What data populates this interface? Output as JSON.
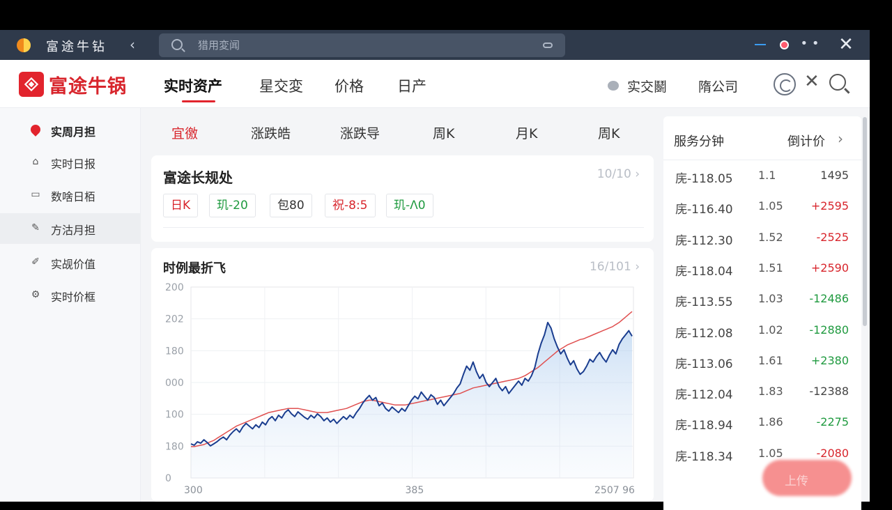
{
  "titlebar": {
    "app_name": "富途牛钻",
    "search_placeholder": "猎用変闻"
  },
  "navbar": {
    "logo": "富途牛锅",
    "tabs": [
      "实时资产",
      "星交変",
      "价格",
      "日产"
    ],
    "right_items": [
      "实交鬭",
      "隋公司"
    ]
  },
  "sidebar": {
    "items": [
      {
        "label": "实周月担",
        "icon": "map-pin-icon"
      },
      {
        "label": "实时日报",
        "icon": "home-icon"
      },
      {
        "label": "数啥日栢",
        "icon": "calendar-icon"
      },
      {
        "label": "方沽月担",
        "icon": "edit-icon"
      },
      {
        "label": "实觇价值",
        "icon": "chart-edit-icon"
      },
      {
        "label": "实时价框",
        "icon": "settings-icon"
      }
    ]
  },
  "subtabs": [
    "宜徼",
    "涨跌皓",
    "涨跌导",
    "周K",
    "月K",
    "周K"
  ],
  "summary_card": {
    "title": "富途长规处",
    "page": "10/10",
    "chips": [
      {
        "text": "日K",
        "tone": "red"
      },
      {
        "text": "玑-20",
        "tone": "green"
      },
      {
        "text": "包80",
        "tone": "dark"
      },
      {
        "text": "祝-8:5",
        "tone": "red"
      },
      {
        "text": "玑-Λ0",
        "tone": "green"
      }
    ]
  },
  "chart_card": {
    "title": "时例最折飞",
    "page": "16/101"
  },
  "chart_data": {
    "type": "line",
    "y_tick_labels": [
      "200",
      "202",
      "180",
      "000",
      "100",
      "180",
      "0"
    ],
    "x_tick_labels": [
      "300",
      "",
      "",
      "385",
      "",
      "",
      "2507 96"
    ],
    "series": [
      {
        "name": "",
        "color": "#1a3d8f",
        "values": [
          130,
          128,
          133,
          131,
          136,
          132,
          127,
          130,
          133,
          137,
          140,
          136,
          143,
          148,
          152,
          147,
          155,
          160,
          156,
          152,
          158,
          154,
          162,
          158,
          166,
          170,
          164,
          172,
          168,
          176,
          180,
          174,
          170,
          177,
          173,
          169,
          166,
          172,
          168,
          174,
          170,
          164,
          168,
          162,
          166,
          160,
          165,
          170,
          166,
          172,
          168,
          176,
          182,
          190,
          196,
          201,
          194,
          198,
          186,
          190,
          182,
          178,
          184,
          180,
          176,
          182,
          178,
          186,
          194,
          200,
          196,
          206,
          200,
          194,
          202,
          198,
          188,
          194,
          186,
          192,
          198,
          204,
          212,
          218,
          232,
          244,
          238,
          250,
          236,
          226,
          232,
          220,
          214,
          220,
          226,
          214,
          208,
          214,
          204,
          210,
          216,
          222,
          216,
          226,
          222,
          230,
          242,
          262,
          278,
          290,
          308,
          300,
          284,
          272,
          262,
          268,
          256,
          246,
          252,
          240,
          232,
          236,
          244,
          254,
          250,
          258,
          264,
          256,
          250,
          260,
          268,
          262,
          276,
          284,
          290,
          296,
          288
        ]
      },
      {
        "name": "",
        "color": "#e05050",
        "values": [
          126,
          126,
          127,
          128,
          129,
          131,
          133,
          135,
          138,
          141,
          144,
          147,
          150,
          153,
          156,
          158,
          160,
          162,
          164,
          166,
          168,
          170,
          172,
          174,
          176,
          177,
          178,
          179,
          180,
          181,
          182,
          182,
          182,
          182,
          181,
          180,
          179,
          178,
          177,
          176,
          176,
          176,
          176,
          177,
          178,
          179,
          180,
          181,
          182,
          184,
          186,
          188,
          190,
          192,
          193,
          194,
          194,
          193,
          192,
          191,
          190,
          189,
          188,
          187,
          187,
          187,
          187,
          188,
          189,
          190,
          191,
          192,
          193,
          194,
          195,
          196,
          197,
          198,
          199,
          200,
          201,
          202,
          203,
          204,
          206,
          208,
          210,
          212,
          213,
          214,
          215,
          216,
          217,
          218,
          219,
          220,
          221,
          222,
          223,
          224,
          225,
          226,
          228,
          230,
          233,
          236,
          239,
          242,
          246,
          250,
          254,
          258,
          262,
          266,
          269,
          272,
          275,
          277,
          279,
          281,
          283,
          284,
          286,
          288,
          290,
          292,
          294,
          296,
          298,
          300,
          302,
          305,
          308,
          312,
          316,
          320,
          324
        ]
      }
    ]
  },
  "right_panel": {
    "header_left": "服务分钟",
    "header_right": "倒计价",
    "rows": [
      {
        "name": "庑-118.05",
        "mid": "1.1",
        "value": "1495",
        "tone": "neu"
      },
      {
        "name": "庑-116.40",
        "mid": "1.05",
        "value": "+2595",
        "tone": "pos"
      },
      {
        "name": "庑-112.30",
        "mid": "1.52",
        "value": "-2525",
        "tone": "pos"
      },
      {
        "name": "庑-118.04",
        "mid": "1.51",
        "value": "+2590",
        "tone": "pos"
      },
      {
        "name": "庑-113.55",
        "mid": "1.03",
        "value": "-12486",
        "tone": "neg"
      },
      {
        "name": "庑-112.08",
        "mid": "1.02",
        "value": "-12880",
        "tone": "neg"
      },
      {
        "name": "庑-113.06",
        "mid": "1.61",
        "value": "+2380",
        "tone": "neg"
      },
      {
        "name": "庑-112.04",
        "mid": "1.83",
        "value": "-12388",
        "tone": "neu"
      },
      {
        "name": "庑-118.94",
        "mid": "1.86",
        "value": "-2275",
        "tone": "neg"
      },
      {
        "name": "庑-118.34",
        "mid": "1.05",
        "value": "-2080",
        "tone": "pos"
      }
    ]
  },
  "fab_label": "上传"
}
